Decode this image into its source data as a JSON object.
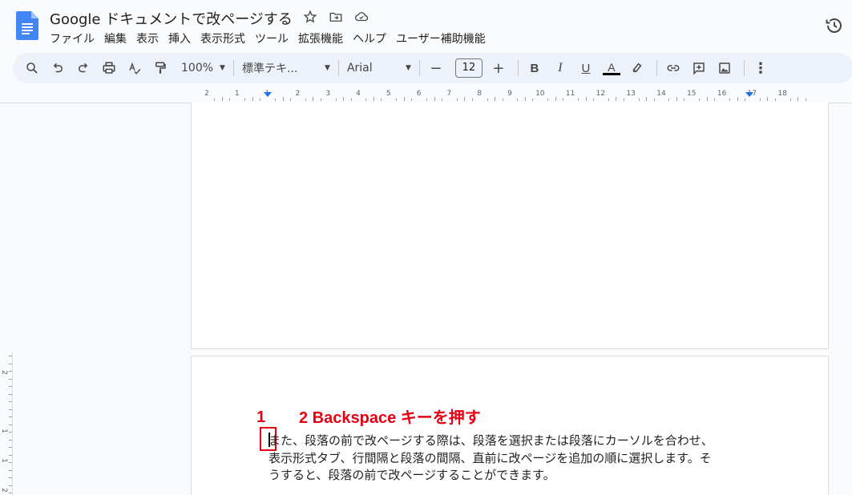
{
  "document": {
    "title": "Google ドキュメントで改ページする"
  },
  "menu": {
    "items": [
      "ファイル",
      "編集",
      "表示",
      "挿入",
      "表示形式",
      "ツール",
      "拡張機能",
      "ヘルプ",
      "ユーザー補助機能"
    ]
  },
  "toolbar": {
    "zoom": "100%",
    "style": "標準テキ...",
    "font": "Arial",
    "font_size": "12",
    "minus": "−",
    "plus": "+"
  },
  "ruler": {
    "numbers": [
      "2",
      "1",
      "1",
      "2",
      "3",
      "4",
      "5",
      "6",
      "7",
      "8",
      "9",
      "10",
      "11",
      "12",
      "13",
      "14",
      "15",
      "16",
      "17",
      "18"
    ]
  },
  "vertical_ruler": {
    "numbers": [
      "2",
      "1",
      "1",
      "2"
    ]
  },
  "annotation": {
    "step1": "1",
    "step2": "2 Backspace キーを押す"
  },
  "body": {
    "lines": [
      "また、段落の前で改ページする際は、段落を選択または段落にカーソルを合わせ、",
      "表示形式タブ、行間隔と段落の間隔、直前に改ページを追加の順に選択します。そ",
      "うすると、段落の前で改ページすることができます。"
    ]
  },
  "icons": {
    "star": "star-icon",
    "move": "move-to-folder-icon",
    "cloud": "cloud-status-icon",
    "history": "history-icon"
  },
  "colors": {
    "accent": "#1a73e8",
    "annotation": "#e60012",
    "toolbar_bg": "#edf2fa"
  }
}
